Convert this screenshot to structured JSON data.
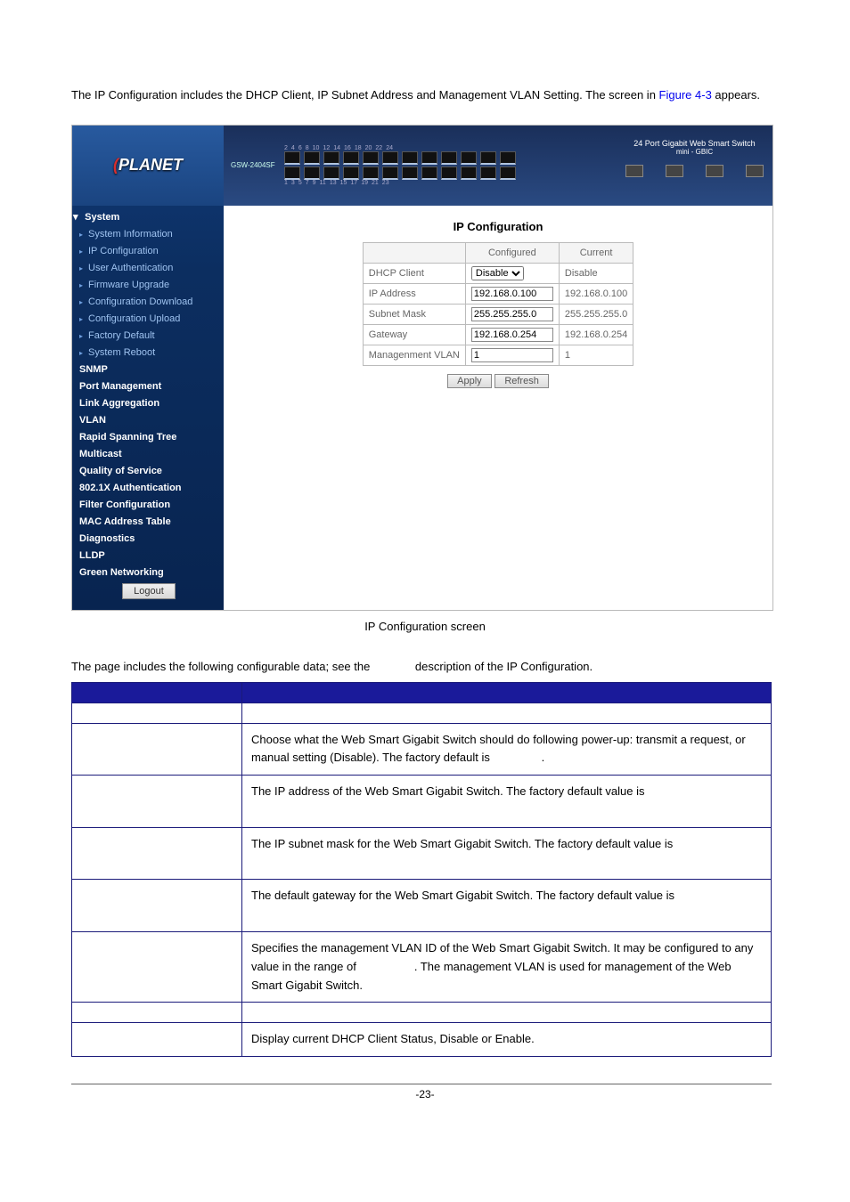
{
  "intro_prefix": "The IP Configuration includes the DHCP Client, IP Subnet Address and Management VLAN Setting.  The screen in ",
  "figure_ref": "Figure 4-3",
  "intro_suffix": " appears.",
  "screenshot": {
    "brand": "PLANET",
    "model": "GSW-2404SF",
    "header_title": "24 Port Gigabit Web Smart Switch",
    "header_sub": "mini - GBIC",
    "port_top_labels": [
      "2",
      "4",
      "6",
      "8",
      "10",
      "12",
      "14",
      "16",
      "18",
      "20",
      "22",
      "24"
    ],
    "port_bottom_labels": [
      "1",
      "3",
      "5",
      "7",
      "9",
      "11",
      "13",
      "15",
      "17",
      "19",
      "21",
      "23"
    ],
    "menu": {
      "system": "System",
      "system_items": [
        "System Information",
        "IP Configuration",
        "User Authentication",
        "Firmware Upgrade",
        "Configuration Download",
        "Configuration Upload",
        "Factory Default",
        "System Reboot"
      ],
      "other": [
        "SNMP",
        "Port Management",
        "Link Aggregation",
        "VLAN",
        "Rapid Spanning Tree",
        "Multicast",
        "Quality of Service",
        "802.1X Authentication",
        "Filter Configuration",
        "MAC Address Table",
        "Diagnostics",
        "LLDP",
        "Green Networking"
      ],
      "logout": "Logout"
    },
    "panel": {
      "title": "IP Configuration",
      "col_configured": "Configured",
      "col_current": "Current",
      "row_dhcp": "DHCP Client",
      "row_ip": "IP Address",
      "row_mask": "Subnet Mask",
      "row_gw": "Gateway",
      "row_vlan": "Managenment VLAN",
      "val_dhcp_sel": "Disable",
      "val_dhcp_cur": "Disable",
      "val_ip_cfg": "192.168.0.100",
      "val_ip_cur": "192.168.0.100",
      "val_mask_cfg": "255.255.255.0",
      "val_mask_cur": "255.255.255.0",
      "val_gw_cfg": "192.168.0.254",
      "val_gw_cur": "192.168.0.254",
      "val_vlan_cfg": "1",
      "val_vlan_cur": "1",
      "btn_apply": "Apply",
      "btn_refresh": "Refresh"
    }
  },
  "caption": "IP Configuration screen",
  "mid_line_a": "The page includes the following configurable data; see the ",
  "mid_line_b": "description of the IP Configuration.",
  "table": {
    "dhcp": "Choose what the Web Smart Gigabit Switch should do following power-up: transmit a request, or manual setting (Disable). The factory default is ",
    "dhcp_tail": ".",
    "ip": "The IP address of the Web Smart Gigabit Switch. The factory default value is",
    "mask": "The IP subnet mask for the Web Smart Gigabit Switch. The factory default value is",
    "gw": "The default gateway for the Web Smart Gigabit Switch. The factory default value is",
    "vlan_a": "Specifies the management VLAN ID of the Web Smart Gigabit Switch. It may be configured to any value in the range of ",
    "vlan_b": ". The management VLAN is used for management of the Web Smart Gigabit Switch.",
    "cur_dhcp": "Display current DHCP Client Status, Disable or Enable."
  },
  "page_number": "-23-"
}
